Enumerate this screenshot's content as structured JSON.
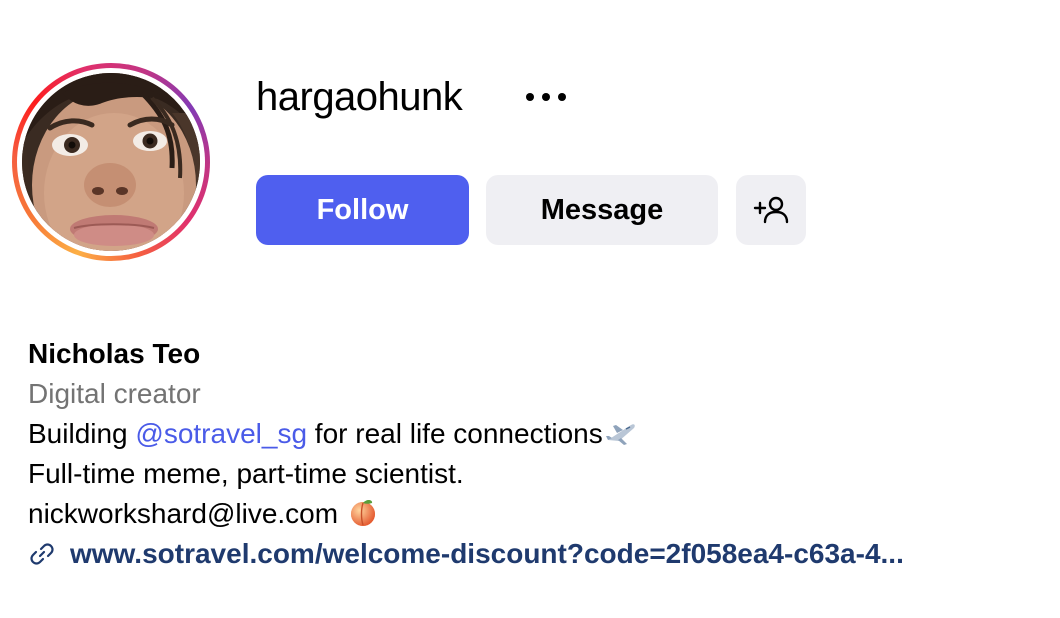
{
  "profile": {
    "username": "hargaohunk",
    "more_icon": "more-horizontal-icon",
    "avatar_icon": "profile-photo"
  },
  "actions": {
    "follow_label": "Follow",
    "message_label": "Message",
    "suggest_icon": "add-person-icon"
  },
  "bio": {
    "full_name": "Nicholas Teo",
    "category": "Digital creator",
    "line1_prefix": "Building ",
    "line1_mention": "@sotravel_sg",
    "line1_suffix": " for real life connections",
    "line1_emoji": "airplane-emoji",
    "line2": "Full-time meme, part-time scientist.",
    "line3_text": "nickworkshard@live.com ",
    "line3_emoji": "peach-emoji",
    "link_icon": "link-icon",
    "link_text": "www.sotravel.com/welcome-discount?code=2f058ea4-c63a-4..."
  },
  "colors": {
    "follow_button": "#4f5fef",
    "secondary_button": "#efeff3",
    "mention": "#4a5be8",
    "link": "#1f3a6e",
    "category": "#737373"
  }
}
